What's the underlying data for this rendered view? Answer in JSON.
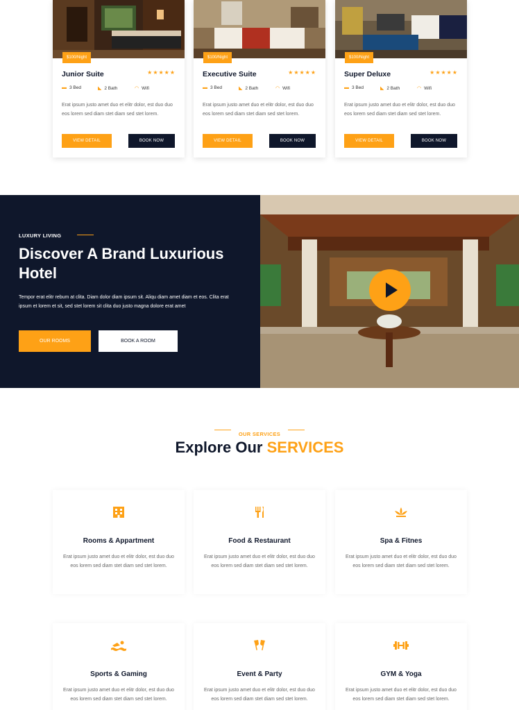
{
  "rooms": [
    {
      "price": "$100/Night",
      "name": "Junior Suite",
      "stars": "★★★★★",
      "bed": "3 Bed",
      "bath": "2 Bath",
      "wifi": "Wifi",
      "desc": "Erat ipsum justo amet duo et elitr dolor, est duo duo eos lorem sed diam stet diam sed stet lorem.",
      "detail": "VIEW DETAIL",
      "book": "BOOK NOW"
    },
    {
      "price": "$100/Night",
      "name": "Executive Suite",
      "stars": "★★★★★",
      "bed": "3 Bed",
      "bath": "2 Bath",
      "wifi": "Wifi",
      "desc": "Erat ipsum justo amet duo et elitr dolor, est duo duo eos lorem sed diam stet diam sed stet lorem.",
      "detail": "VIEW DETAIL",
      "book": "BOOK NOW"
    },
    {
      "price": "$100/Night",
      "name": "Super Deluxe",
      "stars": "★★★★★",
      "bed": "3 Bed",
      "bath": "2 Bath",
      "wifi": "Wifi",
      "desc": "Erat ipsum justo amet duo et elitr dolor, est duo duo eos lorem sed diam stet diam sed stet lorem.",
      "detail": "VIEW DETAIL",
      "book": "BOOK NOW"
    }
  ],
  "hero": {
    "kicker": "LUXURY LIVING",
    "title": "Discover A Brand Luxurious Hotel",
    "text": "Tempor erat elitr rebum at clita. Diam dolor diam ipsum sit. Aliqu diam amet diam et eos. Clita erat ipsum et lorem et sit, sed stet lorem sit clita duo justo magna dolore erat amet",
    "btn_rooms": "OUR ROOMS",
    "btn_book": "BOOK A ROOM"
  },
  "services_section": {
    "kicker": "OUR SERVICES",
    "title_main": "Explore Our ",
    "title_accent": "SERVICES"
  },
  "services": [
    {
      "icon": "hotel-icon",
      "glyph": "🏨",
      "title": "Rooms & Appartment",
      "desc": "Erat ipsum justo amet duo et elitr dolor, est duo duo eos lorem sed diam stet diam sed stet lorem."
    },
    {
      "icon": "utensils-icon",
      "glyph": "🍴",
      "title": "Food & Restaurant",
      "desc": "Erat ipsum justo amet duo et elitr dolor, est duo duo eos lorem sed diam stet diam sed stet lorem."
    },
    {
      "icon": "spa-icon",
      "glyph": "❀",
      "title": "Spa & Fitnes",
      "desc": "Erat ipsum justo amet duo et elitr dolor, est duo duo eos lorem sed diam stet diam sed stet lorem."
    },
    {
      "icon": "swimmer-icon",
      "glyph": "≈",
      "title": "Sports & Gaming",
      "desc": "Erat ipsum justo amet duo et elitr dolor, est duo duo eos lorem sed diam stet diam sed stet lorem."
    },
    {
      "icon": "glass-cheers-icon",
      "glyph": "🥂",
      "title": "Event & Party",
      "desc": "Erat ipsum justo amet duo et elitr dolor, est duo duo eos lorem sed diam stet diam sed stet lorem."
    },
    {
      "icon": "dumbbell-icon",
      "glyph": "⫼",
      "title": "GYM & Yoga",
      "desc": "Erat ipsum justo amet duo et elitr dolor, est duo duo eos lorem sed diam stet diam sed stet lorem."
    }
  ],
  "colors": {
    "accent": "#fea116",
    "dark": "#0f172b"
  }
}
